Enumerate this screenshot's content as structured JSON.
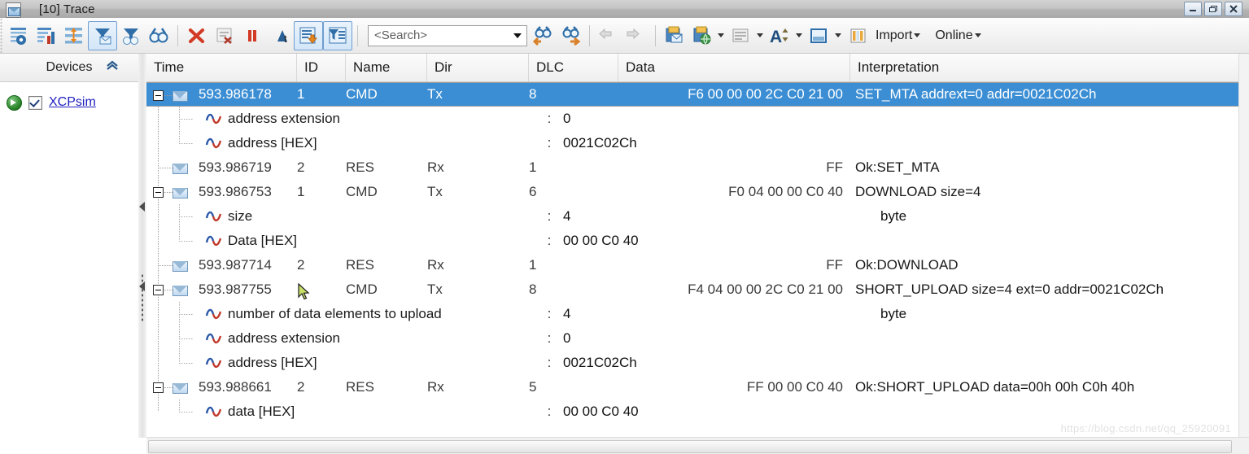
{
  "window": {
    "title": "[10] Trace",
    "doc_icon": "document-envelope-icon",
    "minimize_label": "—",
    "maximize_label": "□",
    "close_label": "✕"
  },
  "toolbar": {
    "buttons": [
      {
        "name": "trace-config-icon",
        "label": "",
        "active": false
      },
      {
        "name": "statistics-icon",
        "label": "",
        "active": false
      },
      {
        "name": "sort-expand-icon",
        "label": "",
        "active": false
      },
      {
        "name": "filter-messages-icon",
        "label": "",
        "active": true
      },
      {
        "name": "remove-filter-icon",
        "label": "",
        "active": false
      },
      {
        "name": "find-icon",
        "label": "",
        "active": false
      },
      {
        "name": "clear-icon",
        "label": "",
        "active": false
      },
      {
        "name": "clear-list-icon",
        "label": "",
        "active": false
      },
      {
        "name": "pause-icon",
        "label": "",
        "active": false
      },
      {
        "name": "time-format-icon",
        "label": "",
        "active": false
      },
      {
        "name": "auto-scroll-icon",
        "label": "",
        "active": true
      },
      {
        "name": "column-filter-icon",
        "label": "",
        "active": true
      }
    ],
    "search": {
      "value": "",
      "placeholder": "<Search>"
    },
    "find_prev_icon": "find-previous-icon",
    "find_next_icon": "find-next-icon",
    "back_icon": "navigate-back-icon",
    "forward_icon": "navigate-forward-icon",
    "copy_icon": "copy-to-clipboard-icon",
    "export_icon": "export-icon",
    "layout_icon": "layout-icon",
    "font_icon": "font-size-icon",
    "window_icon": "window-split-icon",
    "import": {
      "icon": "import-icon",
      "label": "Import"
    },
    "online": {
      "label": "Online"
    }
  },
  "sidebar": {
    "header": "Devices",
    "collapse_icon": "chevron-up-icon",
    "devices": [
      {
        "name": "XCPsim",
        "checked": true,
        "status_icon": "connected-arrow-icon"
      }
    ]
  },
  "grid": {
    "columns": [
      "Time",
      "ID",
      "Name",
      "Dir",
      "DLC",
      "Data",
      "Interpretation"
    ],
    "rows": [
      {
        "kind": "message",
        "expanded": true,
        "selected": true,
        "time": "593.986178",
        "id": "1",
        "name": "CMD",
        "dir": "Tx",
        "dlc": "8",
        "data": "F6  00  00  00  2C  C0  21  00",
        "interpretation": "SET_MTA addrext=0 addr=0021C02Ch"
      },
      {
        "kind": "detail",
        "label": "address extension",
        "colon": ":",
        "value": "0",
        "unit": ""
      },
      {
        "kind": "detail",
        "label": "address [HEX]",
        "colon": ":",
        "value": "0021C02Ch",
        "unit": "",
        "last": true
      },
      {
        "kind": "message",
        "expanded": false,
        "selected": false,
        "time": "593.986719",
        "id": "2",
        "name": "RES",
        "dir": "Rx",
        "dlc": "1",
        "data": "FF",
        "interpretation": "Ok:SET_MTA"
      },
      {
        "kind": "message",
        "expanded": true,
        "selected": false,
        "time": "593.986753",
        "id": "1",
        "name": "CMD",
        "dir": "Tx",
        "dlc": "6",
        "data": "F0  04  00  00  C0  40",
        "interpretation": "DOWNLOAD size=4"
      },
      {
        "kind": "detail",
        "label": "size",
        "colon": ":",
        "value": "4",
        "unit": "byte"
      },
      {
        "kind": "detail",
        "label": "Data [HEX]",
        "colon": ":",
        "value": "00 00 C0 40",
        "unit": "",
        "last": true
      },
      {
        "kind": "message",
        "expanded": false,
        "selected": false,
        "time": "593.987714",
        "id": "2",
        "name": "RES",
        "dir": "Rx",
        "dlc": "1",
        "data": "FF",
        "interpretation": "Ok:DOWNLOAD"
      },
      {
        "kind": "message",
        "expanded": true,
        "selected": false,
        "time": "593.987755",
        "id": "",
        "name": "CMD",
        "dir": "Tx",
        "dlc": "8",
        "data": "F4  04  00  00  2C  C0  21  00",
        "interpretation": "SHORT_UPLOAD size=4 ext=0 addr=0021C02Ch"
      },
      {
        "kind": "detail",
        "label": "number of data elements to upload",
        "colon": ":",
        "value": "4",
        "unit": "byte"
      },
      {
        "kind": "detail",
        "label": "address extension",
        "colon": ":",
        "value": "0",
        "unit": ""
      },
      {
        "kind": "detail",
        "label": "address [HEX]",
        "colon": ":",
        "value": "0021C02Ch",
        "unit": "",
        "last": true
      },
      {
        "kind": "message",
        "expanded": true,
        "selected": false,
        "time": "593.988661",
        "id": "2",
        "name": "RES",
        "dir": "Rx",
        "dlc": "5",
        "data": "FF  00  00  C0  40",
        "interpretation": "Ok:SHORT_UPLOAD data=00h 00h C0h 40h"
      },
      {
        "kind": "detail",
        "label": "data [HEX]",
        "colon": ":",
        "value": "00 00 C0 40",
        "unit": "",
        "last": true
      }
    ]
  },
  "watermark": "https://blog.csdn.net/qq_25920091"
}
